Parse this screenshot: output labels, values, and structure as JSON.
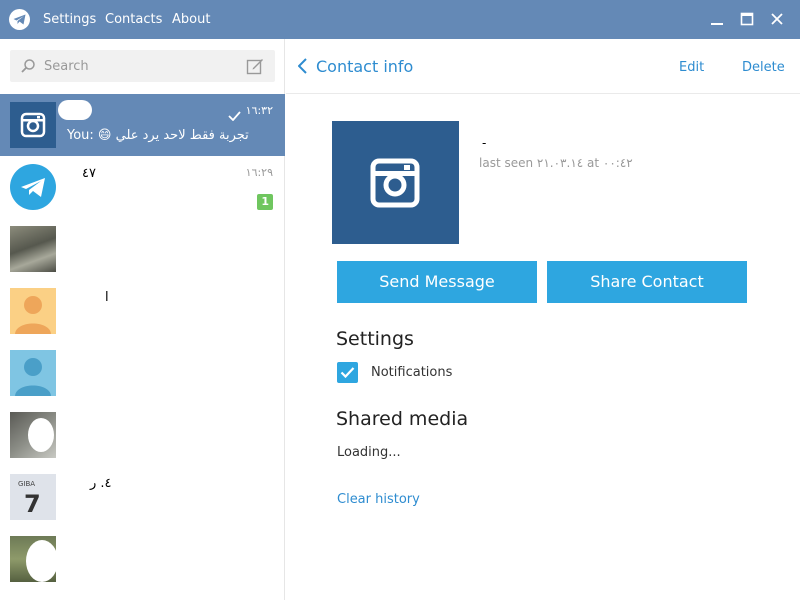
{
  "titlebar": {
    "menu": [
      "Settings",
      "Contacts",
      "About"
    ]
  },
  "search": {
    "placeholder": "Search",
    "value": ""
  },
  "dialogs": [
    {
      "time": "١٦:٣٢",
      "message": "You: 😄 تجربة فقط لاحد يرد علي",
      "active": true
    },
    {
      "name": "٤٧",
      "time": "١٦:٢٩",
      "unread": "1"
    },
    {
      "name": ""
    },
    {
      "name": "ا"
    },
    {
      "name": ""
    },
    {
      "name": ""
    },
    {
      "name": "٤. ر"
    },
    {
      "name": ""
    }
  ],
  "header": {
    "back_label": "Contact info",
    "edit_label": "Edit",
    "delete_label": "Delete"
  },
  "contact": {
    "name": "-",
    "status": "last seen ٢١.٠٣.١٤ at ٠٠:٤٢"
  },
  "actions": {
    "send_message": "Send Message",
    "share_contact": "Share Contact"
  },
  "settings": {
    "title": "Settings",
    "notifications_label": "Notifications",
    "notifications_checked": true
  },
  "shared_media": {
    "title": "Shared media",
    "loading": "Loading..."
  },
  "clear_history": "Clear history",
  "colors": {
    "titlebar": "#6489b6",
    "accent": "#2ea6e0",
    "link": "#2e8cd0",
    "unread_badge": "#6fc65f",
    "contact_avatar": "#2d5d8f"
  }
}
